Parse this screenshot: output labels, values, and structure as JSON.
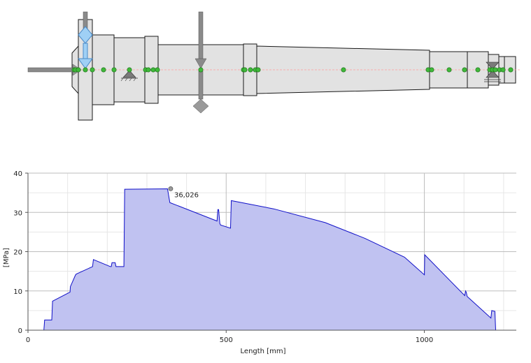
{
  "shaft": {
    "sections": [
      {
        "x0": 103,
        "x1": 112,
        "r": 34,
        "taper": "left"
      },
      {
        "x0": 112,
        "x1": 132,
        "r": 72
      },
      {
        "x0": 132,
        "x1": 163,
        "r": 50
      },
      {
        "x0": 163,
        "x1": 207,
        "r": 46
      },
      {
        "x0": 207,
        "x1": 226,
        "r": 48
      },
      {
        "x0": 226,
        "x1": 348,
        "r": 36
      },
      {
        "x0": 348,
        "x1": 367,
        "r": 37
      },
      {
        "x0": 367,
        "x1": 614,
        "r": 34,
        "taper_end_r": 28
      },
      {
        "x0": 614,
        "x1": 668,
        "r": 26
      },
      {
        "x0": 668,
        "x1": 698,
        "r": 26
      },
      {
        "x0": 698,
        "x1": 713,
        "r": 22
      },
      {
        "x0": 713,
        "x1": 721,
        "r": 19
      },
      {
        "x0": 721,
        "x1": 737,
        "r": 19
      }
    ],
    "nodes_x": [
      106,
      108,
      112,
      122,
      132,
      148,
      163,
      185,
      208,
      212,
      219,
      225,
      287,
      348,
      350,
      358,
      365,
      369,
      491,
      612,
      617,
      642,
      664,
      683,
      700,
      704,
      708,
      714,
      719,
      730
    ],
    "colors": {
      "body": "#e2e2e2",
      "outline": "#1a1a1a",
      "node": "#3fb83a",
      "axis": "#ff8a8a",
      "load": "#8a8a8a",
      "bearing_blue": "#8fc4f0"
    }
  },
  "chart_data": {
    "type": "area",
    "title": "",
    "xlabel": "Length [mm]",
    "ylabel": "[MPa]",
    "xlim": [
      0,
      1232
    ],
    "ylim": [
      0,
      40
    ],
    "x_ticks": [
      0,
      500,
      1000
    ],
    "y_ticks": [
      0,
      10,
      20,
      30,
      40
    ],
    "grid": true,
    "fill_color": "#c0c2f1",
    "line_color": "#1010c8",
    "series": [
      {
        "x": [
          40,
          42,
          60,
          62,
          106,
          107,
          120,
          122,
          163,
          165,
          208,
          210,
          212,
          220,
          222,
          242,
          244,
          352,
          354,
          358,
          477,
          479,
          481,
          484,
          486,
          511,
          513,
          620,
          750,
          850,
          950,
          1000,
          1001,
          1102,
          1104,
          1106,
          1108,
          1168,
          1170,
          1178,
          1180
        ],
        "y": [
          0,
          2.6,
          2.6,
          7.4,
          9.7,
          11.1,
          14.1,
          14.3,
          16.2,
          18.0,
          16.2,
          16.2,
          17.2,
          17.2,
          16.2,
          16.2,
          35.9,
          36.0,
          34.8,
          32.5,
          27.8,
          30.7,
          30.7,
          27.2,
          26.8,
          26.0,
          33.0,
          30.9,
          27.4,
          23.4,
          18.6,
          14.1,
          19.2,
          8.8,
          10.0,
          9.6,
          8.6,
          3.1,
          5.0,
          4.8,
          0
        ]
      }
    ],
    "max_point": {
      "x": 360,
      "y": 36.026,
      "label": "36,026"
    }
  }
}
